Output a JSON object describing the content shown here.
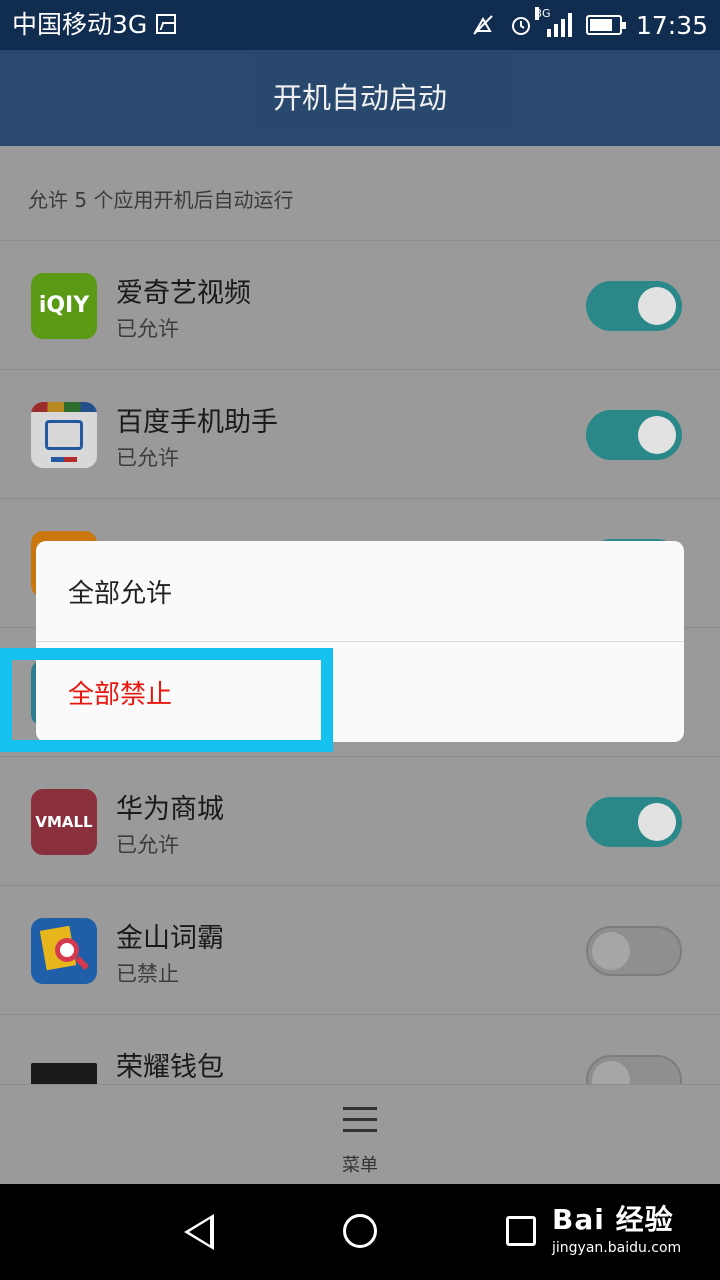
{
  "status_bar": {
    "carrier": "中国移动3G",
    "network_type": "3G",
    "time": "17:35",
    "icons": [
      "image-icon",
      "mute-icon",
      "alarm-icon",
      "signal-icon",
      "battery-icon"
    ]
  },
  "header": {
    "title": "开机自动启动"
  },
  "main": {
    "subtitle": "允许 5 个应用开机后自动运行",
    "apps": [
      {
        "name": "爱奇艺视频",
        "status": "已允许",
        "enabled": true,
        "icon": "iqiyi-icon",
        "icon_text": "iQIY"
      },
      {
        "name": "百度手机助手",
        "status": "已允许",
        "enabled": true,
        "icon": "baidu-assistant-icon"
      },
      {
        "name": "",
        "status": "",
        "enabled": true,
        "icon": "app-icon-orange"
      },
      {
        "name": "",
        "status": "",
        "enabled": true,
        "icon": "app-icon-teal"
      },
      {
        "name": "华为商城",
        "status": "已允许",
        "enabled": true,
        "icon": "vmall-icon",
        "icon_text": "VMALL"
      },
      {
        "name": "金山词霸",
        "status": "已禁止",
        "enabled": false,
        "icon": "jinshan-icon"
      },
      {
        "name": "荣耀钱包",
        "status": "",
        "enabled": false,
        "icon": "wallet-icon"
      }
    ]
  },
  "dialog": {
    "allow_all": "全部允许",
    "deny_all": "全部禁止"
  },
  "bottom_menu": {
    "label": "菜单",
    "icon": "menu-icon"
  },
  "nav_bar": {
    "watermark_main": "Bai 经验",
    "watermark_sub": "jingyan.baidu.com"
  },
  "colors": {
    "title_bar": "#143a65",
    "status_bar": "#102c4f",
    "toggle_on": "#2a8888",
    "deny_text": "#e8160c",
    "highlight": "#14c1ef"
  }
}
